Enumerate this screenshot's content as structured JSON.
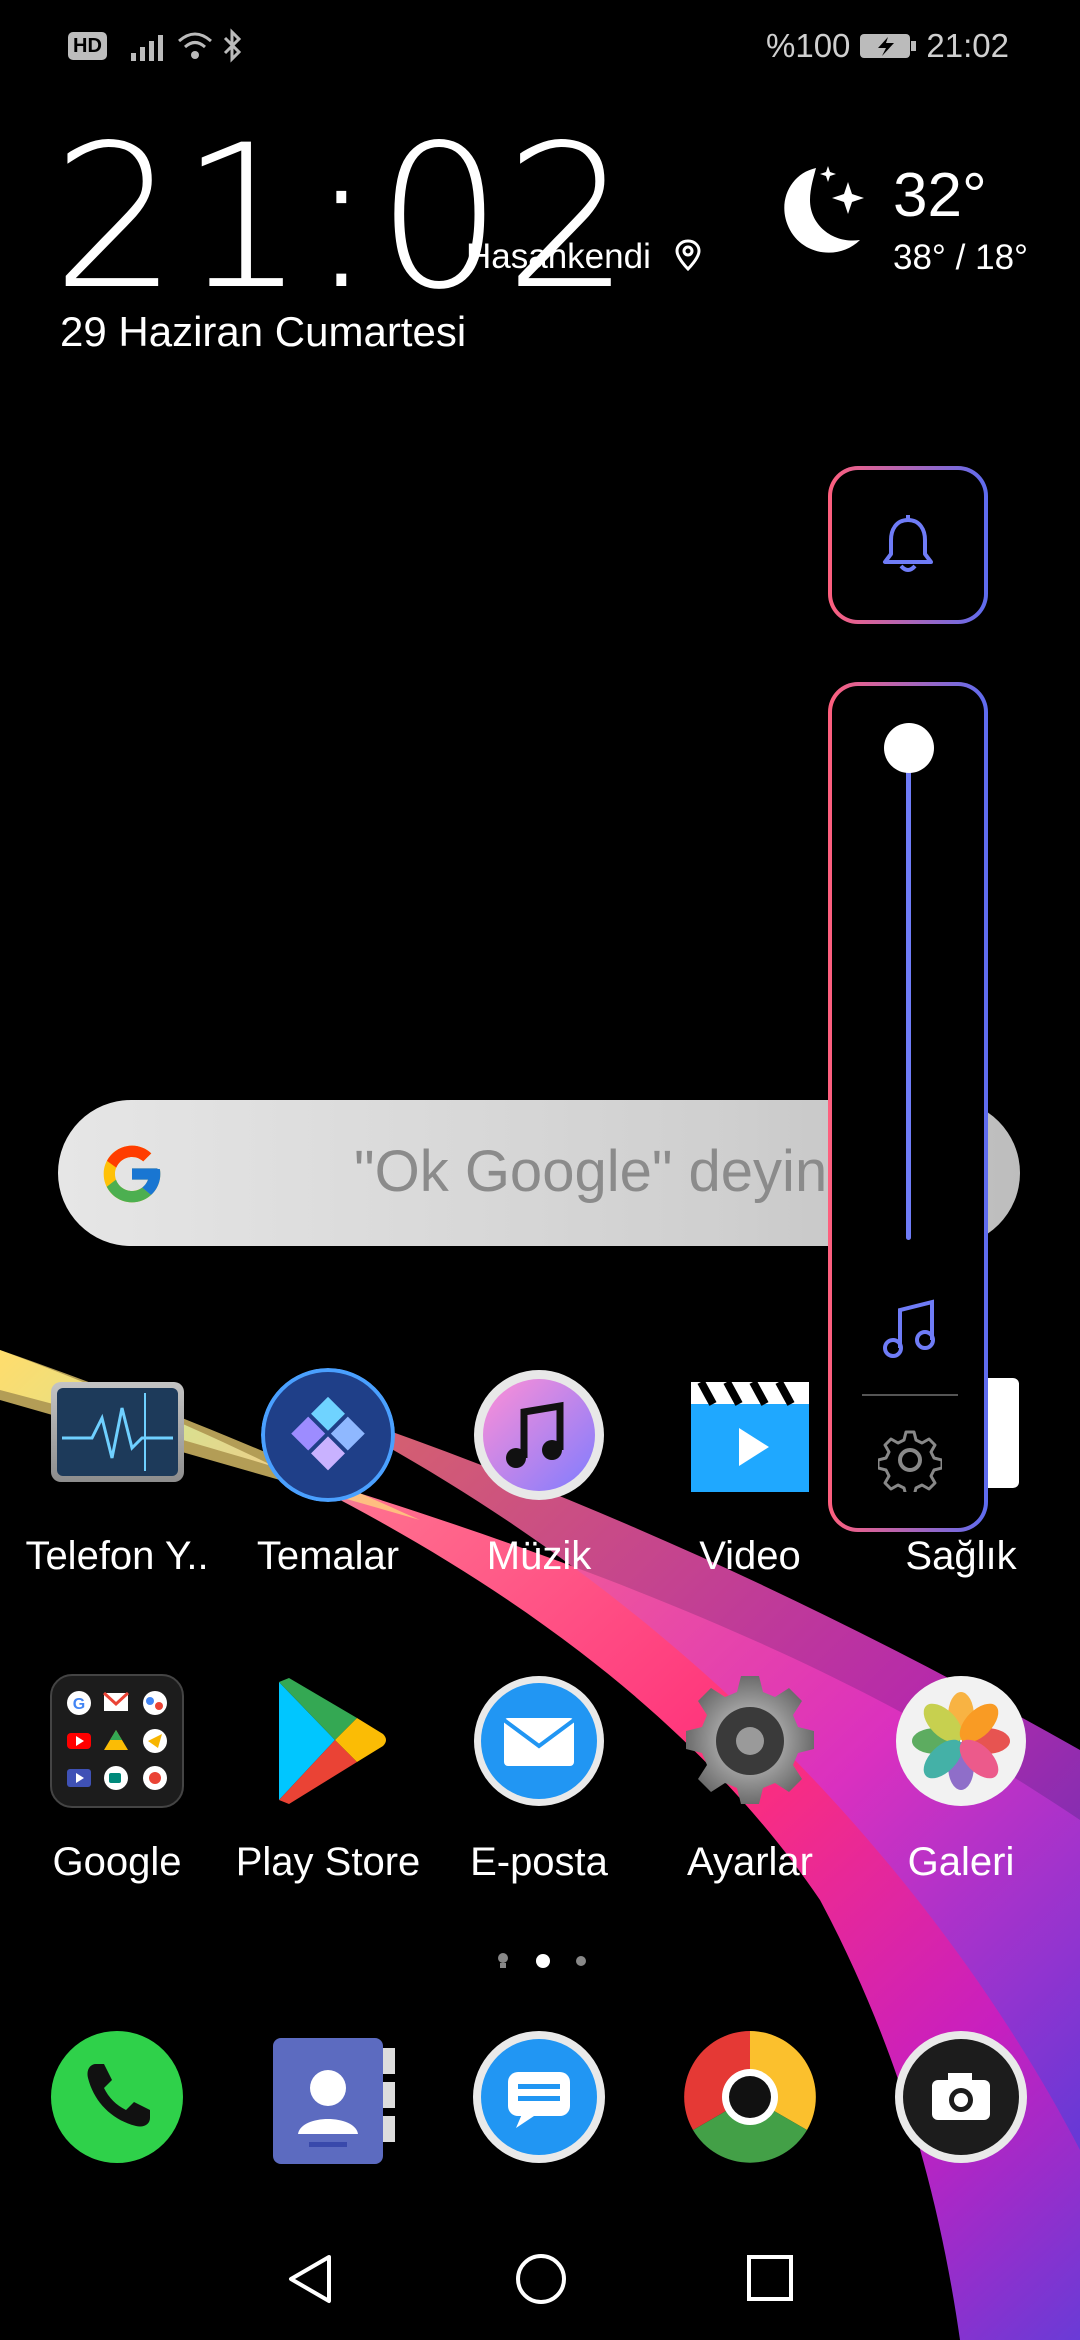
{
  "status_bar": {
    "hd_label": "HD",
    "battery_percent": "%100",
    "time": "21:02",
    "icons": [
      "hd-icon",
      "signal-icon",
      "wifi-icon",
      "bluetooth-icon",
      "battery-charging-icon"
    ]
  },
  "clock_widget": {
    "time": "21:02",
    "location": "Hasankendi",
    "date": "29 Haziran Cumartesi",
    "temperature": "32°",
    "temp_range": "38° / 18°",
    "weather_icon": "moon-stars-icon"
  },
  "search": {
    "placeholder": "\"Ok Google\" deyin"
  },
  "volume_panel": {
    "level": 1.0,
    "accent_start": "#ff5f7d",
    "accent_end": "#5d6cf0"
  },
  "apps_row1": [
    {
      "label": "Telefon Y..",
      "icon": "phone-manager-icon"
    },
    {
      "label": "Temalar",
      "icon": "themes-icon"
    },
    {
      "label": "Müzik",
      "icon": "music-icon"
    },
    {
      "label": "Video",
      "icon": "video-icon"
    },
    {
      "label": "Sağlık",
      "icon": "health-icon"
    }
  ],
  "apps_row2": [
    {
      "label": "Google",
      "icon": "google-folder-icon"
    },
    {
      "label": "Play Store",
      "icon": "play-store-icon"
    },
    {
      "label": "E-posta",
      "icon": "email-icon"
    },
    {
      "label": "Ayarlar",
      "icon": "settings-icon"
    },
    {
      "label": "Galeri",
      "icon": "gallery-icon"
    }
  ],
  "page_indicator": {
    "pages": 3,
    "current": 2
  },
  "dock": [
    "phone-icon",
    "contacts-icon",
    "messages-icon",
    "chrome-icon",
    "camera-icon"
  ],
  "nav_bar": [
    "back-icon",
    "home-icon",
    "recents-icon"
  ]
}
